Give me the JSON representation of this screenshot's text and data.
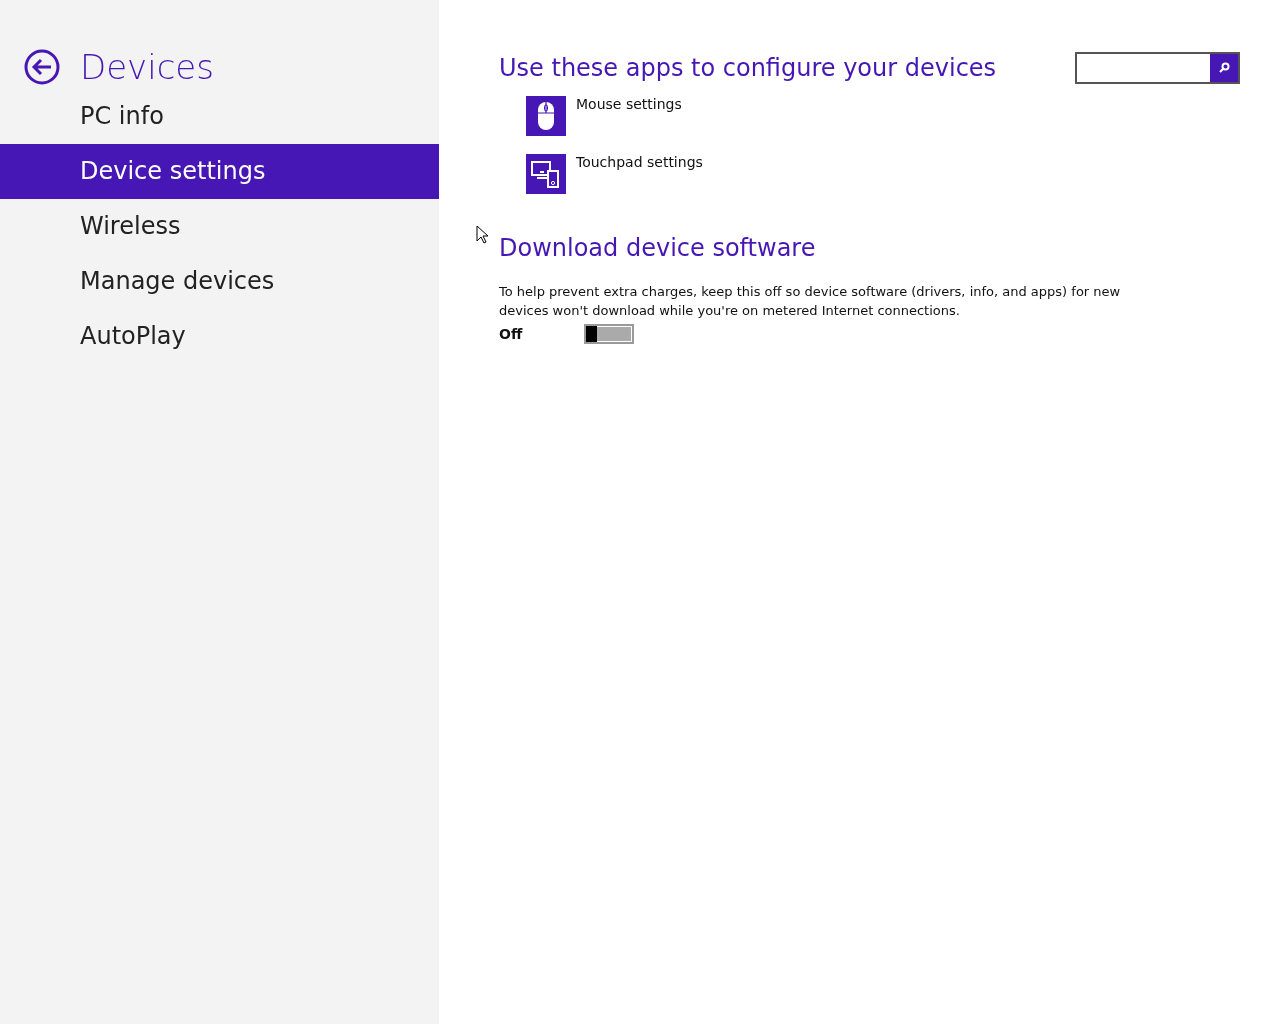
{
  "sidebar": {
    "title": "Devices",
    "items": [
      {
        "label": "PC info",
        "selected": false
      },
      {
        "label": "Device settings",
        "selected": true
      },
      {
        "label": "Wireless",
        "selected": false
      },
      {
        "label": "Manage devices",
        "selected": false
      },
      {
        "label": "AutoPlay",
        "selected": false
      }
    ]
  },
  "apps_section": {
    "heading": "Use these apps to configure your devices",
    "apps": [
      {
        "kind": "mouse",
        "label": "Mouse settings"
      },
      {
        "kind": "touchpad",
        "label": "Touchpad settings"
      }
    ]
  },
  "download_section": {
    "heading": "Download device software",
    "description": "To help prevent extra charges, keep this off so device software (drivers, info, and apps) for new devices won't download while you're on metered Internet connections.",
    "toggle": {
      "label": "Off",
      "on": false
    }
  }
}
